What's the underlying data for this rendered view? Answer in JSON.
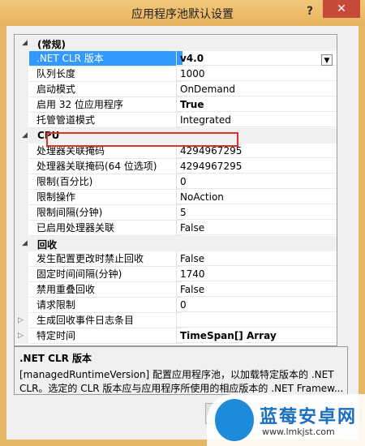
{
  "window": {
    "title": "应用程序池默认设置",
    "help_label": "?",
    "close_label": "✕"
  },
  "properties": [
    {
      "type": "category",
      "label": "(常规)",
      "expander": "◢"
    },
    {
      "type": "property",
      "name": ".NET CLR 版本",
      "value": "v4.0",
      "selected": true,
      "bold": true,
      "dropdown": true
    },
    {
      "type": "property",
      "name": "队列长度",
      "value": "1000"
    },
    {
      "type": "property",
      "name": "启动模式",
      "value": "OnDemand"
    },
    {
      "type": "property",
      "name": "启用 32 位应用程序",
      "value": "True",
      "bold": true,
      "highlighted": true
    },
    {
      "type": "property",
      "name": "托管管道模式",
      "value": "Integrated"
    },
    {
      "type": "category",
      "label": "CPU",
      "expander": "◢"
    },
    {
      "type": "property",
      "name": "处理器关联掩码",
      "value": "4294967295"
    },
    {
      "type": "property",
      "name": "处理器关联掩码(64 位选项)",
      "value": "4294967295"
    },
    {
      "type": "property",
      "name": "限制(百分比)",
      "value": "0"
    },
    {
      "type": "property",
      "name": "限制操作",
      "value": "NoAction"
    },
    {
      "type": "property",
      "name": "限制间隔(分钟)",
      "value": "5"
    },
    {
      "type": "property",
      "name": "已启用处理器关联",
      "value": "False"
    },
    {
      "type": "category",
      "label": "回收",
      "expander": "◢"
    },
    {
      "type": "property",
      "name": "发生配置更改时禁止回收",
      "value": "False"
    },
    {
      "type": "property",
      "name": "固定时间间隔(分钟)",
      "value": "1740"
    },
    {
      "type": "property",
      "name": "禁用重叠回收",
      "value": "False"
    },
    {
      "type": "property",
      "name": "请求限制",
      "value": "0"
    },
    {
      "type": "property",
      "name": "生成回收事件日志条目",
      "value": "",
      "sub_expander": "▷"
    },
    {
      "type": "property",
      "name": "特定时间",
      "value": "TimeSpan[] Array",
      "bold": true,
      "sub_expander": "▷"
    }
  ],
  "description": {
    "title": ".NET CLR 版本",
    "lines": [
      "[managedRuntimeVersion] 配置应用程序池，以加载特定版本的 .NET",
      "CLR。选定的 CLR 版本应与应用程序所使用的相应版本的 .NET Framew..."
    ]
  },
  "scrollbar": {
    "up_icon": "▲",
    "down_icon": "▼"
  },
  "dropdown_icon": "▼",
  "watermark": {
    "name": "蓝莓安卓网",
    "url": "www.lmkjst.com"
  },
  "colors": {
    "selection": "#3399ff",
    "highlight_box": "#d9342b",
    "title_bar": "#e7b35e",
    "close_button": "#c7493a"
  }
}
